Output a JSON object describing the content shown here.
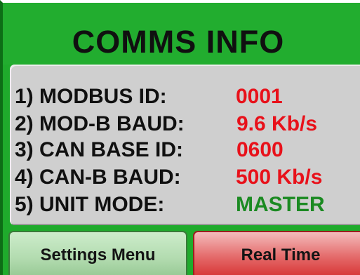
{
  "header": {
    "title": "COMMS INFO"
  },
  "info": {
    "rows": [
      {
        "label": "1) MODBUS ID:",
        "value": "0001",
        "value_color": "#e8111a"
      },
      {
        "label": "2) MOD-B BAUD:",
        "value": "9.6 Kb/s",
        "value_color": "#e8111a"
      },
      {
        "label": "3) CAN BASE ID:",
        "value": "0600",
        "value_color": "#e8111a"
      },
      {
        "label": "4) CAN-B BAUD:",
        "value": "500 Kb/s",
        "value_color": "#e8111a"
      },
      {
        "label": "5) UNIT MODE:",
        "value": "MASTER",
        "value_color": "#1b8a22"
      }
    ]
  },
  "buttons": {
    "settings_label": "Settings Menu",
    "realtime_label": "Real Time"
  },
  "colors": {
    "background": "#1fab2c",
    "panel": "#cfcfcf",
    "value_red": "#e8111a",
    "value_green": "#1b8a22"
  }
}
